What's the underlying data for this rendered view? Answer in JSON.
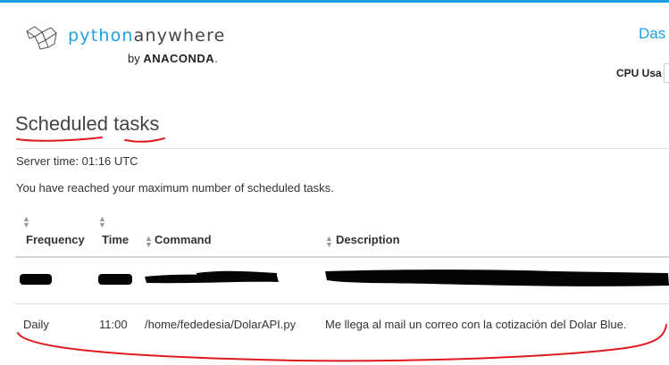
{
  "brand": {
    "python": "python",
    "anywhere": "anywhere",
    "by": "by",
    "anaconda": "ANACONDA",
    "dot": "."
  },
  "nav": {
    "dashboard_fragment": "Das",
    "cpu_usage_fragment": "CPU Usa"
  },
  "page": {
    "title": "Scheduled tasks",
    "server_time": "Server time: 01:16 UTC",
    "limit_message": "You have reached your maximum number of scheduled tasks."
  },
  "table": {
    "columns": [
      "Frequency",
      "Time",
      "Command",
      "Description"
    ],
    "rows": [
      {
        "redacted": true
      },
      {
        "frequency": "Daily",
        "time": "11:00",
        "command": "/home/fededesia/DolarAPI.py",
        "description": "Me llega al mail un correo con la cotización del Dolar Blue."
      }
    ]
  },
  "icons": {
    "logo": "python-anywhere-logo-icon",
    "sort": "sort-arrows-icon"
  },
  "colors": {
    "accent": "#1d9fe0",
    "annotation": "#e0191e",
    "redaction": "#050505"
  }
}
